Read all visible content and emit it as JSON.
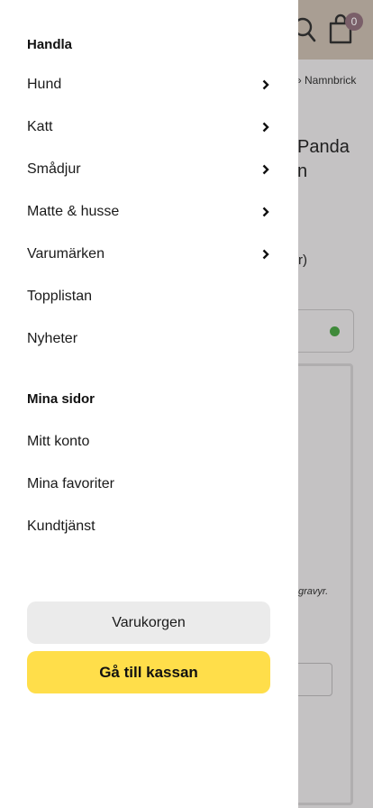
{
  "drawer": {
    "shop_heading": "Handla",
    "shop_items": [
      {
        "label": "Hund",
        "has_children": true
      },
      {
        "label": "Katt",
        "has_children": true
      },
      {
        "label": "Smådjur",
        "has_children": true
      },
      {
        "label": "Matte & husse",
        "has_children": true
      },
      {
        "label": "Varumärken",
        "has_children": true
      },
      {
        "label": "Topplistan",
        "has_children": false
      },
      {
        "label": "Nyheter",
        "has_children": false
      }
    ],
    "account_heading": "Mina sidor",
    "account_items": [
      {
        "label": "Mitt konto"
      },
      {
        "label": "Mina favoriter"
      },
      {
        "label": "Kundtjänst"
      }
    ],
    "basket_button": "Varukorgen",
    "checkout_button": "Gå till kassan"
  },
  "background": {
    "cart_count": "0",
    "breadcrumb": "» Namnbrick",
    "title_line1": "Panda",
    "title_line2": "n",
    "text_fragment": "r)",
    "italic_fragment": "gravyr."
  },
  "colors": {
    "checkout_bg": "#ffde4a",
    "basket_bg": "#ebebeb",
    "header_bg": "#a99e93",
    "status_dot": "#3f8a3a",
    "badge_bg": "#7a5f69"
  }
}
